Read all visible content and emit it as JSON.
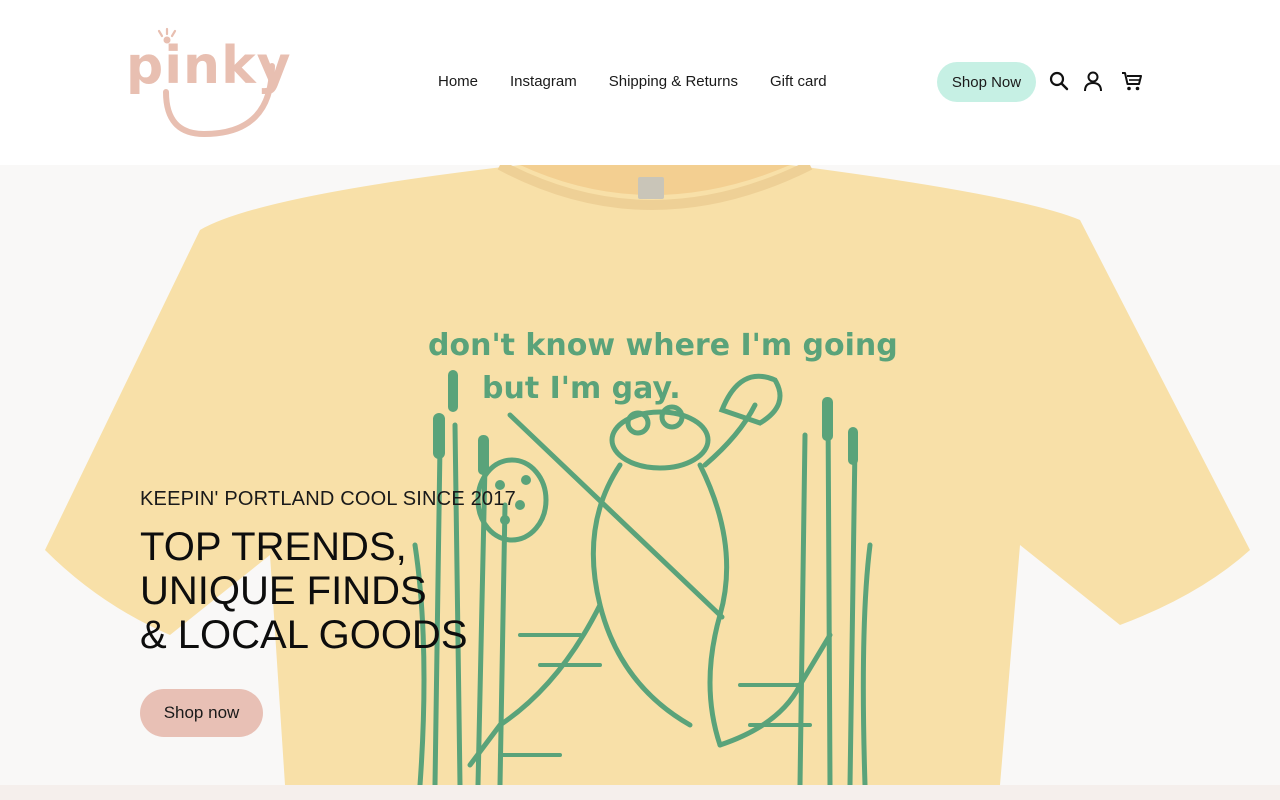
{
  "brand": {
    "logo_text": "pinky",
    "logo_color": "#e8bfb1"
  },
  "nav": {
    "items": [
      {
        "label": "Home"
      },
      {
        "label": "Instagram"
      },
      {
        "label": "Shipping & Returns"
      },
      {
        "label": "Gift card"
      }
    ]
  },
  "header_actions": {
    "shop_now_label": "Shop Now",
    "shop_now_color": "#c6f0e4",
    "icons": [
      "search-icon",
      "account-icon",
      "cart-icon"
    ]
  },
  "hero": {
    "subtitle": "KEEPIN' PORTLAND COOL SINCE 2017",
    "title_lines": [
      "TOP TRENDS,",
      "UNIQUE FINDS",
      "& LOCAL GOODS"
    ],
    "button_label": "Shop now",
    "button_color": "#e8c0b5",
    "image": {
      "shirt_color": "#f8e0a8",
      "print_color": "#5aa37a",
      "print_line_1": "don't know where I'm going",
      "print_line_2": "but I'm gay."
    }
  }
}
